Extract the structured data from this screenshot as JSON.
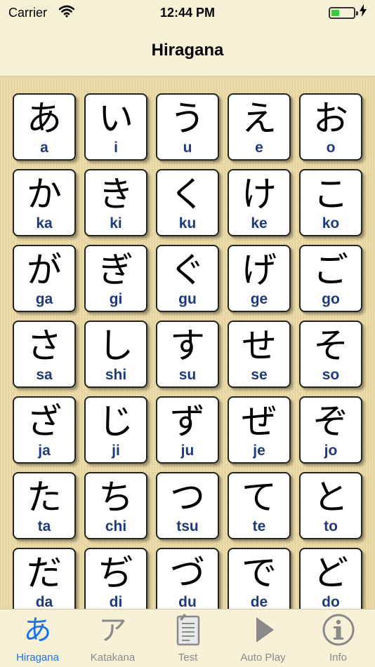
{
  "status_bar": {
    "carrier": "Carrier",
    "time": "12:44 PM",
    "battery_level": 0.35
  },
  "nav": {
    "title": "Hiragana"
  },
  "colors": {
    "accent": "#1a73e8",
    "romaji": "#1f3a7a",
    "inactive_tab": "#8a8a8a",
    "battery": "#3cc93c"
  },
  "cards": [
    {
      "kana": "あ",
      "romaji": "a"
    },
    {
      "kana": "い",
      "romaji": "i"
    },
    {
      "kana": "う",
      "romaji": "u"
    },
    {
      "kana": "え",
      "romaji": "e"
    },
    {
      "kana": "お",
      "romaji": "o"
    },
    {
      "kana": "か",
      "romaji": "ka"
    },
    {
      "kana": "き",
      "romaji": "ki"
    },
    {
      "kana": "く",
      "romaji": "ku"
    },
    {
      "kana": "け",
      "romaji": "ke"
    },
    {
      "kana": "こ",
      "romaji": "ko"
    },
    {
      "kana": "が",
      "romaji": "ga"
    },
    {
      "kana": "ぎ",
      "romaji": "gi"
    },
    {
      "kana": "ぐ",
      "romaji": "gu"
    },
    {
      "kana": "げ",
      "romaji": "ge"
    },
    {
      "kana": "ご",
      "romaji": "go"
    },
    {
      "kana": "さ",
      "romaji": "sa"
    },
    {
      "kana": "し",
      "romaji": "shi"
    },
    {
      "kana": "す",
      "romaji": "su"
    },
    {
      "kana": "せ",
      "romaji": "se"
    },
    {
      "kana": "そ",
      "romaji": "so"
    },
    {
      "kana": "ざ",
      "romaji": "ja"
    },
    {
      "kana": "じ",
      "romaji": "ji"
    },
    {
      "kana": "ず",
      "romaji": "ju"
    },
    {
      "kana": "ぜ",
      "romaji": "je"
    },
    {
      "kana": "ぞ",
      "romaji": "jo"
    },
    {
      "kana": "た",
      "romaji": "ta"
    },
    {
      "kana": "ち",
      "romaji": "chi"
    },
    {
      "kana": "つ",
      "romaji": "tsu"
    },
    {
      "kana": "て",
      "romaji": "te"
    },
    {
      "kana": "と",
      "romaji": "to"
    },
    {
      "kana": "だ",
      "romaji": "da"
    },
    {
      "kana": "ぢ",
      "romaji": "di"
    },
    {
      "kana": "づ",
      "romaji": "du"
    },
    {
      "kana": "で",
      "romaji": "de"
    },
    {
      "kana": "ど",
      "romaji": "do"
    }
  ],
  "tabs": [
    {
      "label": "Hiragana",
      "icon": "hiragana-a-icon",
      "glyph": "あ",
      "active": true
    },
    {
      "label": "Katakana",
      "icon": "katakana-a-icon",
      "glyph": "ア",
      "active": false
    },
    {
      "label": "Test",
      "icon": "test-sheet-icon",
      "active": false
    },
    {
      "label": "Auto Play",
      "icon": "play-icon",
      "active": false
    },
    {
      "label": "Info",
      "icon": "info-icon",
      "active": false
    }
  ]
}
